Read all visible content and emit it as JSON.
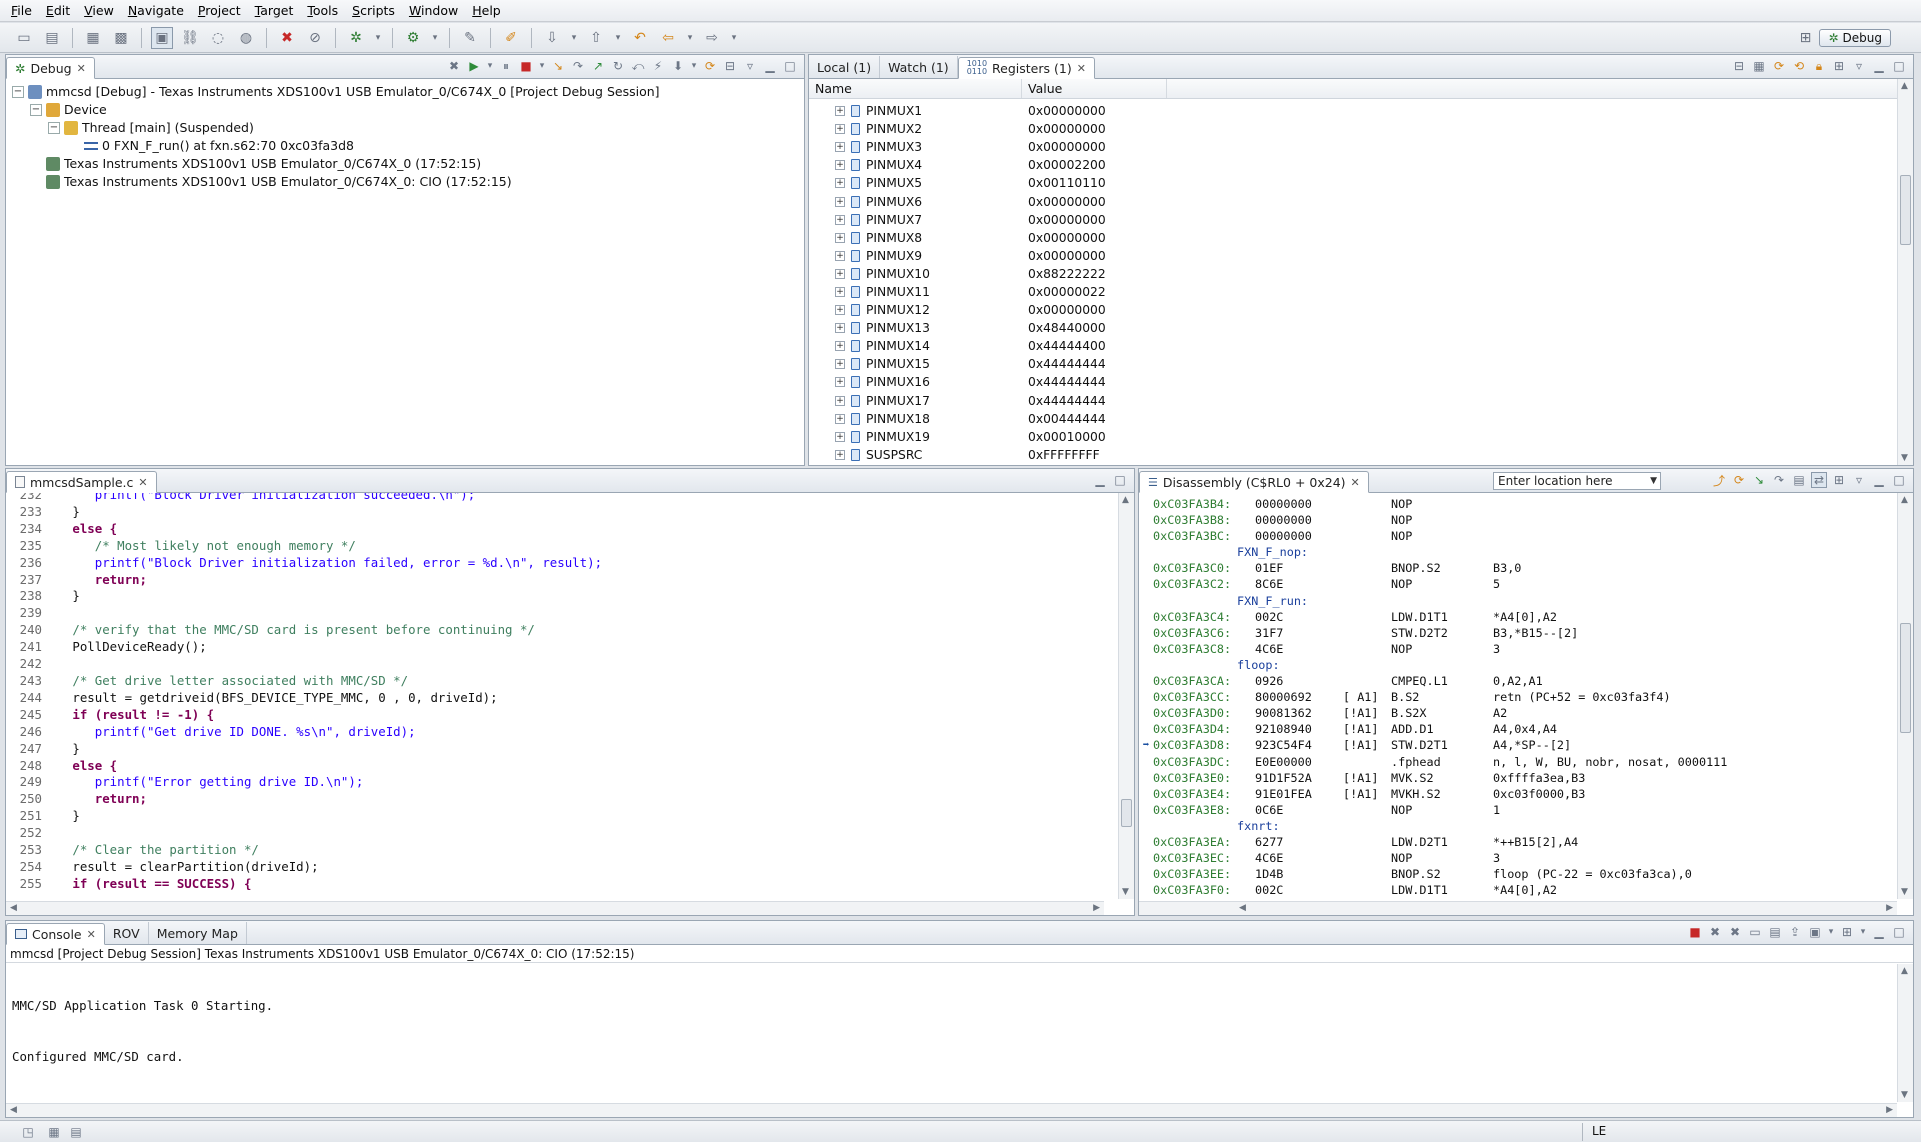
{
  "menu": [
    "File",
    "Edit",
    "View",
    "Navigate",
    "Project",
    "Target",
    "Tools",
    "Scripts",
    "Window",
    "Help"
  ],
  "perspective": {
    "label": "Debug"
  },
  "debug_view": {
    "tab": "Debug",
    "tree": [
      {
        "label": "mmcsd [Debug] - Texas Instruments XDS100v1 USB Emulator_0/C674X_0 [Project Debug Session]",
        "level": 0
      },
      {
        "label": "Device",
        "level": 1
      },
      {
        "label": "Thread [main] (Suspended)",
        "level": 2
      },
      {
        "label": "0 FXN_F_run() at fxn.s62:70 0xc03fa3d8",
        "level": 3
      },
      {
        "label": "Texas Instruments XDS100v1 USB Emulator_0/C674X_0 (17:52:15)",
        "level": 1
      },
      {
        "label": "Texas Instruments XDS100v1 USB Emulator_0/C674X_0: CIO (17:52:15)",
        "level": 1
      }
    ]
  },
  "registers_view": {
    "tabs": [
      "Local (1)",
      "Watch (1)",
      "Registers (1)"
    ],
    "columns": [
      "Name",
      "Value"
    ],
    "rows": [
      {
        "name": "PINMUX1",
        "value": "0x00000000"
      },
      {
        "name": "PINMUX2",
        "value": "0x00000000"
      },
      {
        "name": "PINMUX3",
        "value": "0x00000000"
      },
      {
        "name": "PINMUX4",
        "value": "0x00002200"
      },
      {
        "name": "PINMUX5",
        "value": "0x00110110"
      },
      {
        "name": "PINMUX6",
        "value": "0x00000000"
      },
      {
        "name": "PINMUX7",
        "value": "0x00000000"
      },
      {
        "name": "PINMUX8",
        "value": "0x00000000"
      },
      {
        "name": "PINMUX9",
        "value": "0x00000000"
      },
      {
        "name": "PINMUX10",
        "value": "0x88222222"
      },
      {
        "name": "PINMUX11",
        "value": "0x00000022"
      },
      {
        "name": "PINMUX12",
        "value": "0x00000000"
      },
      {
        "name": "PINMUX13",
        "value": "0x48440000"
      },
      {
        "name": "PINMUX14",
        "value": "0x44444400"
      },
      {
        "name": "PINMUX15",
        "value": "0x44444444"
      },
      {
        "name": "PINMUX16",
        "value": "0x44444444"
      },
      {
        "name": "PINMUX17",
        "value": "0x44444444"
      },
      {
        "name": "PINMUX18",
        "value": "0x00444444"
      },
      {
        "name": "PINMUX19",
        "value": "0x00010000"
      },
      {
        "name": "SUSPSRC",
        "value": "0xFFFFFFFF"
      }
    ]
  },
  "editor": {
    "tab": "mmcsdSample.c",
    "lines": [
      {
        "n": "232",
        "t": "      printf(\"Block Driver initialization succeeded.\\n\");",
        "k": "str"
      },
      {
        "n": "233",
        "t": "   }",
        "k": ""
      },
      {
        "n": "234",
        "t": "   else {",
        "k": "kw"
      },
      {
        "n": "235",
        "t": "      /* Most likely not enough memory */",
        "k": "cmt"
      },
      {
        "n": "236",
        "t": "      printf(\"Block Driver initialization failed, error = %d.\\n\", result);",
        "k": "str"
      },
      {
        "n": "237",
        "t": "      return;",
        "k": "kw"
      },
      {
        "n": "238",
        "t": "   }",
        "k": ""
      },
      {
        "n": "239",
        "t": "",
        "k": ""
      },
      {
        "n": "240",
        "t": "   /* verify that the MMC/SD card is present before continuing */",
        "k": "cmt"
      },
      {
        "n": "241",
        "t": "   PollDeviceReady();",
        "k": ""
      },
      {
        "n": "242",
        "t": "",
        "k": ""
      },
      {
        "n": "243",
        "t": "   /* Get drive letter associated with MMC/SD */",
        "k": "cmt"
      },
      {
        "n": "244",
        "t": "   result = getdriveid(BFS_DEVICE_TYPE_MMC, 0 , 0, driveId);",
        "k": ""
      },
      {
        "n": "245",
        "t": "   if (result != -1) {",
        "k": "kw"
      },
      {
        "n": "246",
        "t": "      printf(\"Get drive ID DONE. %s\\n\", driveId);",
        "k": "str"
      },
      {
        "n": "247",
        "t": "   }",
        "k": ""
      },
      {
        "n": "248",
        "t": "   else {",
        "k": "kw"
      },
      {
        "n": "249",
        "t": "      printf(\"Error getting drive ID.\\n\");",
        "k": "str"
      },
      {
        "n": "250",
        "t": "      return;",
        "k": "kw"
      },
      {
        "n": "251",
        "t": "   }",
        "k": ""
      },
      {
        "n": "252",
        "t": "",
        "k": ""
      },
      {
        "n": "253",
        "t": "   /* Clear the partition */",
        "k": "cmt"
      },
      {
        "n": "254",
        "t": "   result = clearPartition(driveId);",
        "k": ""
      },
      {
        "n": "255",
        "t": "   if (result == SUCCESS) {",
        "k": "kw"
      }
    ]
  },
  "disassembly": {
    "tab": "Disassembly (C$RL0 + 0x24)",
    "location_placeholder": "Enter location here",
    "rows": [
      {
        "ad": "0xC03FA3B4:",
        "op": "00000000",
        "pr": "",
        "mn": "NOP",
        "ar": ""
      },
      {
        "ad": "0xC03FA3B8:",
        "op": "00000000",
        "pr": "",
        "mn": "NOP",
        "ar": ""
      },
      {
        "ad": "0xC03FA3BC:",
        "op": "00000000",
        "pr": "",
        "mn": "NOP",
        "ar": ""
      },
      {
        "label": "FXN_F_nop:"
      },
      {
        "ad": "0xC03FA3C0:",
        "op": "01EF",
        "pr": "",
        "mn": "BNOP.S2",
        "ar": "B3,0"
      },
      {
        "ad": "0xC03FA3C2:",
        "op": "8C6E",
        "pr": "",
        "mn": "NOP",
        "ar": "5"
      },
      {
        "label": "FXN_F_run:"
      },
      {
        "ad": "0xC03FA3C4:",
        "op": "002C",
        "pr": "",
        "mn": "LDW.D1T1",
        "ar": "*A4[0],A2"
      },
      {
        "ad": "0xC03FA3C6:",
        "op": "31F7",
        "pr": "",
        "mn": "STW.D2T2",
        "ar": "B3,*B15--[2]"
      },
      {
        "ad": "0xC03FA3C8:",
        "op": "4C6E",
        "pr": "",
        "mn": "NOP",
        "ar": "3"
      },
      {
        "label": "floop:"
      },
      {
        "ad": "0xC03FA3CA:",
        "op": "0926",
        "pr": "",
        "mn": "CMPEQ.L1",
        "ar": "0,A2,A1"
      },
      {
        "ad": "0xC03FA3CC:",
        "op": "80000692",
        "pr": "[ A1]",
        "mn": "B.S2",
        "ar": "retn (PC+52 = 0xc03fa3f4)"
      },
      {
        "ad": "0xC03FA3D0:",
        "op": "90081362",
        "pr": "[!A1]",
        "mn": "B.S2X",
        "ar": "A2"
      },
      {
        "ad": "0xC03FA3D4:",
        "op": "92108940",
        "pr": "[!A1]",
        "mn": "ADD.D1",
        "ar": "A4,0x4,A4"
      },
      {
        "ad": "0xC03FA3D8:",
        "op": "923C54F4",
        "pr": "[!A1]",
        "mn": "STW.D2T1",
        "ar": "A4,*SP--[2]",
        "current": true
      },
      {
        "ad": "0xC03FA3DC:",
        "op": "E0E00000",
        "pr": "",
        "mn": ".fphead",
        "ar": "n, l, W, BU, nobr, nosat, 0000111"
      },
      {
        "ad": "0xC03FA3E0:",
        "op": "91D1F52A",
        "pr": "[!A1]",
        "mn": "MVK.S2",
        "ar": "0xffffa3ea,B3"
      },
      {
        "ad": "0xC03FA3E4:",
        "op": "91E01FEA",
        "pr": "[!A1]",
        "mn": "MVKH.S2",
        "ar": "0xc03f0000,B3"
      },
      {
        "ad": "0xC03FA3E8:",
        "op": "0C6E",
        "pr": "",
        "mn": "NOP",
        "ar": "1"
      },
      {
        "label": "fxnrt:"
      },
      {
        "ad": "0xC03FA3EA:",
        "op": "6277",
        "pr": "",
        "mn": "LDW.D2T1",
        "ar": "*++B15[2],A4"
      },
      {
        "ad": "0xC03FA3EC:",
        "op": "4C6E",
        "pr": "",
        "mn": "NOP",
        "ar": "3"
      },
      {
        "ad": "0xC03FA3EE:",
        "op": "1D4B",
        "pr": "",
        "mn": "BNOP.S2",
        "ar": "floop (PC-22 = 0xc03fa3ca),0"
      },
      {
        "ad": "0xC03FA3F0:",
        "op": "002C",
        "pr": "",
        "mn": "LDW.D1T1",
        "ar": "*A4[0],A2"
      }
    ]
  },
  "console": {
    "tabs": [
      "Console",
      "ROV",
      "Memory Map"
    ],
    "session": "mmcsd [Project Debug Session] Texas Instruments XDS100v1 USB Emulator_0/C674X_0: CIO (17:52:15)",
    "lines": [
      "MMC/SD Application Task 0 Starting.",
      "Configured MMC/SD card."
    ]
  },
  "status": {
    "mode": "LE"
  }
}
